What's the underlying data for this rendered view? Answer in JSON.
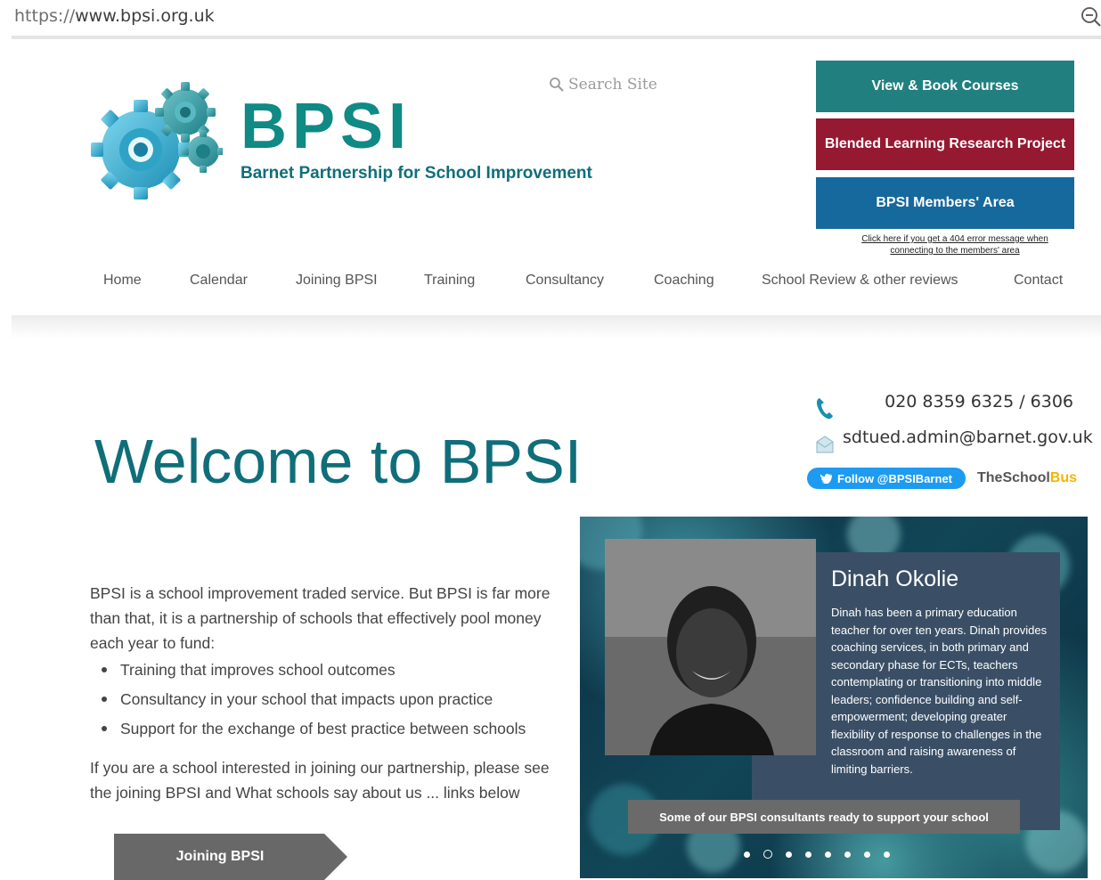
{
  "browser": {
    "url_scheme": "https://",
    "url_host": "www.bpsi.org.uk",
    "zoom_icon": "zoom-out-icon"
  },
  "header": {
    "logo_icon": "gears-logo-icon",
    "brand": "BPSI",
    "brand_subtitle": "Barnet Partnership for School Improvement",
    "search_placeholder": "Search Site",
    "cta_buttons": [
      "View & Book Courses",
      "Blended Learning Research Project",
      "BPSI Members' Area"
    ],
    "error_link": "Click here if you get a 404 error message when connecting to the members' area",
    "colors": {
      "teal": "#21807f",
      "crimson": "#951931",
      "blue": "#16699c"
    }
  },
  "nav": {
    "items": [
      "Home",
      "Calendar",
      "Joining BPSI",
      "Training",
      "Consultancy",
      "Coaching",
      "School Review & other reviews",
      "Contact"
    ]
  },
  "contact": {
    "phone": "020 8359 6325 / 6306",
    "email": "sdtued.admin@barnet.gov.uk",
    "twitter": "Follow @BPSIBarnet",
    "schoolbus_a": "TheSchool",
    "schoolbus_b": "Bus"
  },
  "main": {
    "title": "Welcome to BPSI",
    "intro": "BPSI is a school improvement traded service. But BPSI is far more than that, it is a partnership of schools that effectively pool money each year to fund:",
    "bullets": [
      "Training that improves school outcomes",
      "Consultancy in your school that impacts upon practice",
      "Support for the exchange of best practice between schools"
    ],
    "intro2": "If you are a school interested in joining our partnership, please see the joining BPSI and What schools say about us ... links below",
    "join_button": "Joining BPSI"
  },
  "slider": {
    "name": "Dinah Okolie",
    "text": "Dinah has been a primary education teacher for over ten years. Dinah provides coaching services, in both primary and secondary phase for ECTs, teachers contemplating or transitioning into middle leaders; confidence building and self-empowerment; developing greater flexibility of response to challenges in the classroom and raising awareness of limiting barriers.",
    "banner": "Some of our BPSI consultants ready to support your school",
    "dot_count": 8,
    "active_dot": 2
  }
}
